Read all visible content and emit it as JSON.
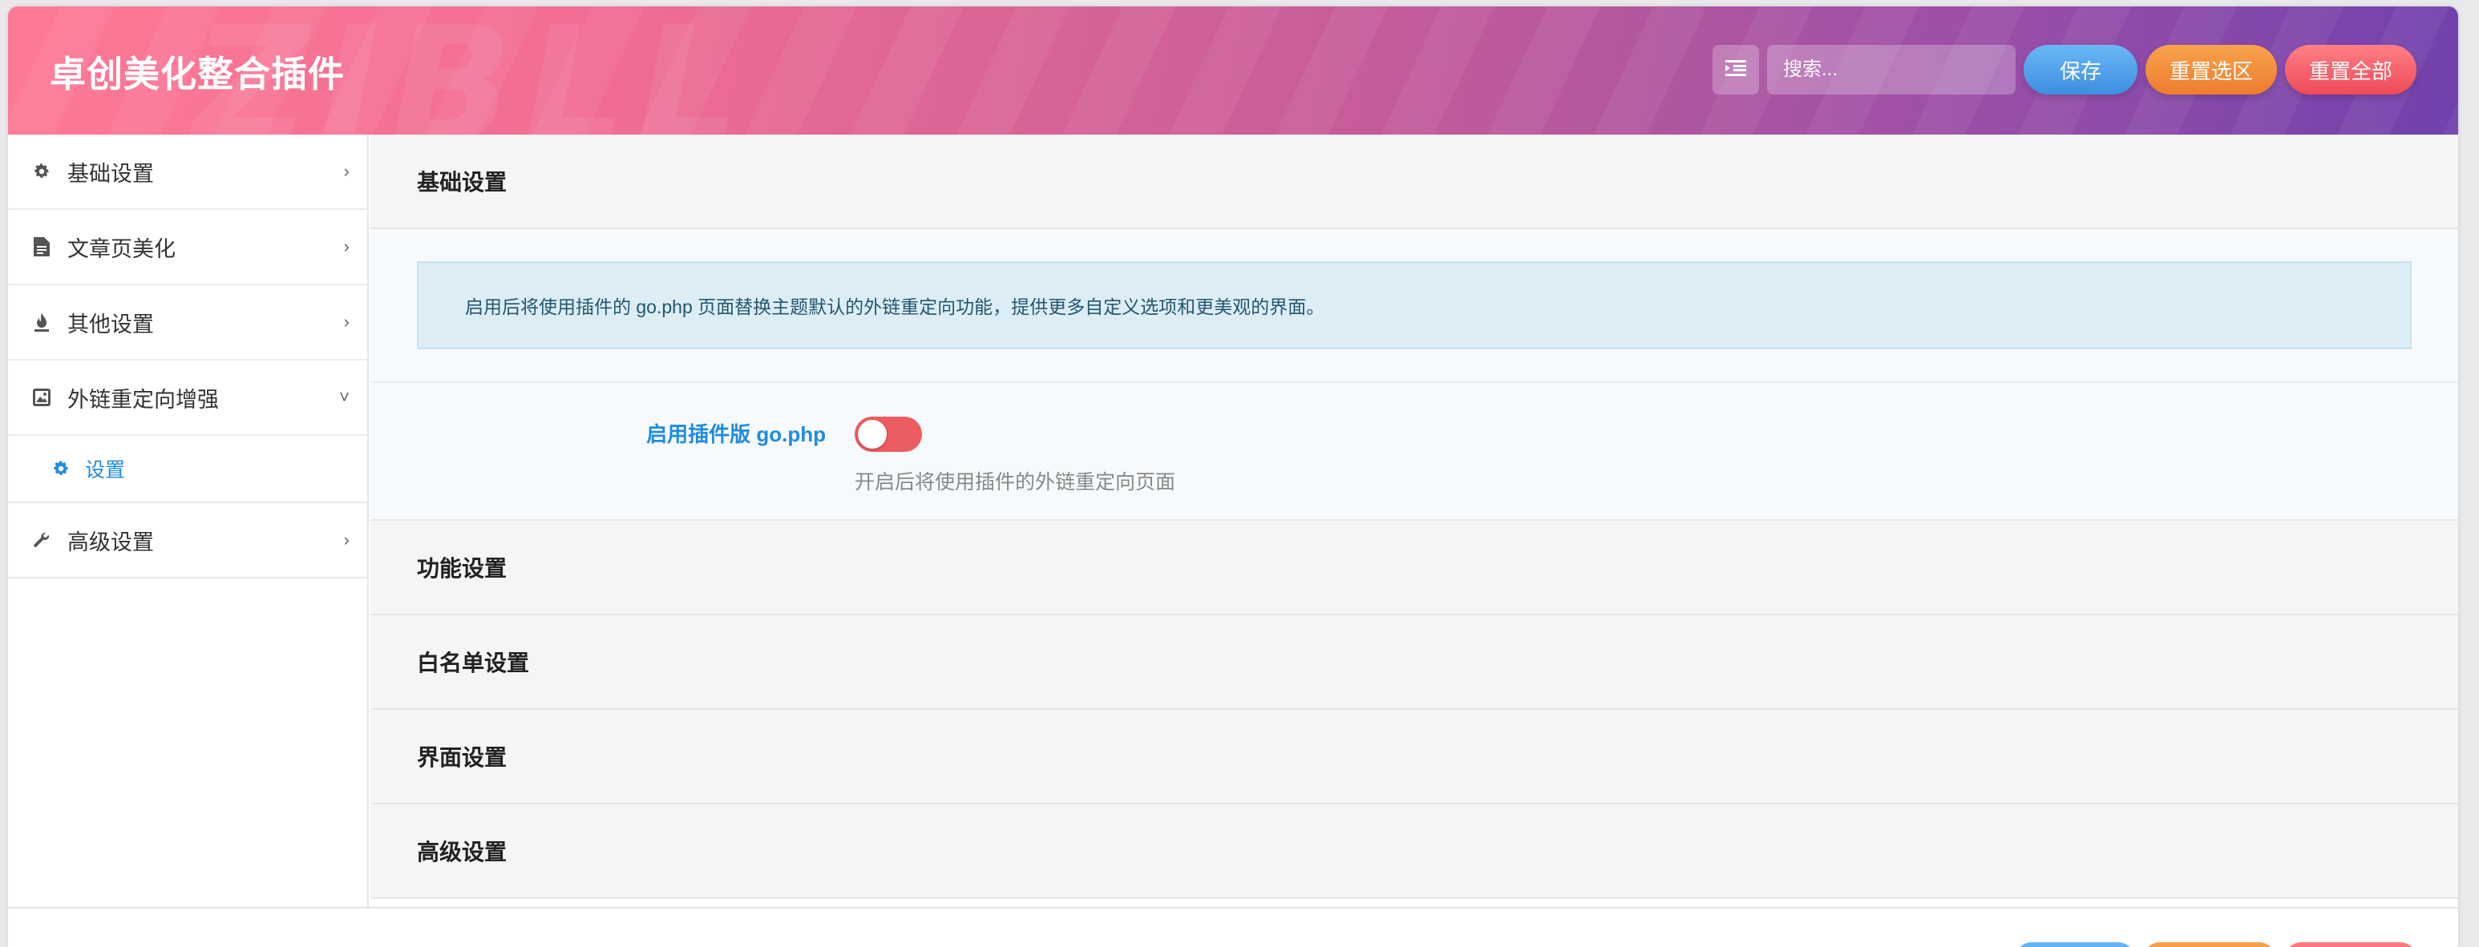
{
  "header": {
    "title": "卓创美化整合插件",
    "watermark": "ZIBLL",
    "search_placeholder": "搜索...",
    "save_label": "保存",
    "reset_section_label": "重置选区",
    "reset_all_label": "重置全部"
  },
  "sidebar": {
    "items": [
      {
        "label": "基础设置",
        "icon": "gear-icon",
        "expanded": false
      },
      {
        "label": "文章页美化",
        "icon": "document-icon",
        "expanded": false
      },
      {
        "label": "其他设置",
        "icon": "flame-icon",
        "expanded": false
      },
      {
        "label": "外链重定向增强",
        "icon": "image-icon",
        "expanded": true
      },
      {
        "label": "高级设置",
        "icon": "wrench-icon",
        "expanded": false
      }
    ],
    "sub_items": [
      {
        "label": "设置",
        "icon": "gear-icon",
        "active": true
      }
    ]
  },
  "main": {
    "section_title": "基础设置",
    "notice": "启用后将使用插件的 go.php 页面替换主题默认的外链重定向功能，提供更多自定义选项和更美观的界面。",
    "field": {
      "label": "启用插件版 go.php",
      "enabled": false,
      "description": "开启后将使用插件的外链重定向页面"
    },
    "accordions": [
      "功能设置",
      "白名单设置",
      "界面设置",
      "高级设置"
    ]
  },
  "colors": {
    "header_gradient_start": "#fd7a95",
    "header_gradient_end": "#7041ad",
    "accent_blue": "#1e8ce0",
    "switch_off": "#ec5d62",
    "save": "#3f8ee0",
    "reset_section": "#ed7d2e",
    "reset_all": "#ef4a59"
  }
}
